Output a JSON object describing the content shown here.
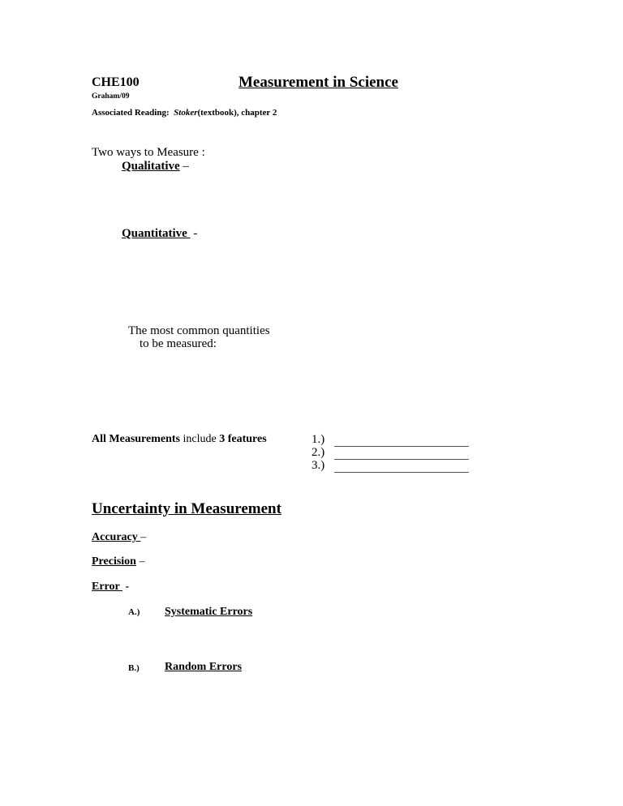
{
  "header": {
    "course_code": "CHE100",
    "title": "Measurement in Science",
    "author": "Graham/09",
    "reading_label": "Associated Reading:",
    "reading_book": "Stoker",
    "reading_rest": "(textbook), chapter 2"
  },
  "measure_section": {
    "intro": "Two ways to Measure :",
    "qualitative_term": "Qualitative",
    "qualitative_sep": " –",
    "quantitative_term": "Quantitative ",
    "quantitative_sep": " -",
    "common_line1": "The most common quantities",
    "common_line2": "to be measured:"
  },
  "features": {
    "label_bold_1": "All Measurements",
    "label_plain": " include ",
    "label_bold_2": "3 features",
    "items": [
      {
        "number": "1.)",
        "value": ""
      },
      {
        "number": "2.)",
        "value": ""
      },
      {
        "number": "3.)",
        "value": ""
      }
    ]
  },
  "uncertainty": {
    "heading": "Uncertainty in Measurement",
    "accuracy_term": "Accuracy ",
    "accuracy_sep": "–",
    "precision_term": "Precision",
    "precision_sep": " –",
    "error_term": "Error ",
    "error_sep": " -",
    "error_types": [
      {
        "label": "A.)",
        "title": "Systematic Errors"
      },
      {
        "label": "B.)",
        "title": "Random Errors"
      }
    ]
  }
}
